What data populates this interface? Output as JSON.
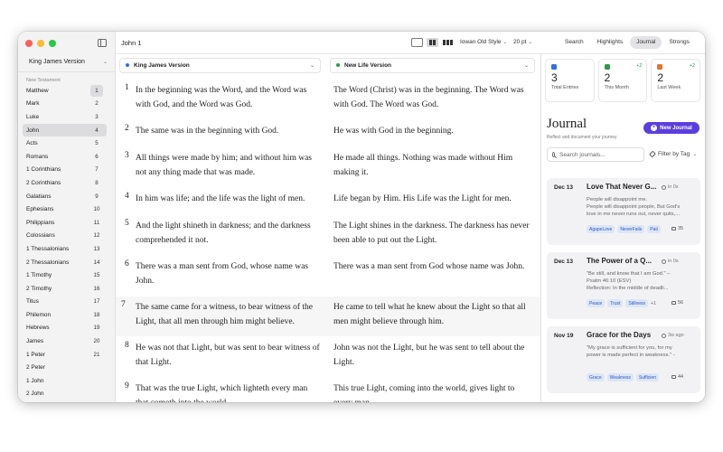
{
  "toolbar": {
    "chapter_title": "John 1",
    "font": "Iowan Old Style",
    "font_size": "20 pt",
    "segments": [
      "Search",
      "Highlights",
      "Journal",
      "Strongs"
    ],
    "active_segment": "Journal"
  },
  "sidebar": {
    "version": "King James Version",
    "section_label": "New Testament",
    "books": [
      "Matthew",
      "Mark",
      "Luke",
      "John",
      "Acts",
      "Romans",
      "1 Corinthians",
      "2 Corinthians",
      "Galatians",
      "Ephesians",
      "Philippians",
      "Colossians",
      "1 Thessalonians",
      "2 Thessalonians",
      "1 Timothy",
      "2 Timothy",
      "Titus",
      "Philemon",
      "Hebrews",
      "James",
      "1 Peter",
      "2 Peter",
      "1 John",
      "2 John"
    ],
    "active_book": "John",
    "chapters": [
      "1",
      "2",
      "3",
      "4",
      "5",
      "6",
      "7",
      "8",
      "9",
      "10",
      "11",
      "12",
      "13",
      "14",
      "15",
      "16",
      "17",
      "18",
      "19",
      "20",
      "21"
    ],
    "active_chapter": "1"
  },
  "bible": {
    "left_version": "King James Version",
    "right_version": "New Life Version",
    "left_dot_color": "#2f6fe0",
    "right_dot_color": "#2e9c4b",
    "highlighted_verse": "7",
    "verses": [
      {
        "num": "1",
        "kjv": "In the beginning was the Word, and the Word was with God, and the Word was God.",
        "nlv": "The Word (Christ) was in the beginning. The Word was with God. The Word was God."
      },
      {
        "num": "2",
        "kjv": "The same was in the beginning with God.",
        "nlv": "He was with God in the beginning."
      },
      {
        "num": "3",
        "kjv": "All things were made by him; and without him was not any thing made that was made.",
        "nlv": "He made all things. Nothing was made without Him making it."
      },
      {
        "num": "4",
        "kjv": "In him was life; and the life was the light of men.",
        "nlv": "Life began by Him. His Life was the Light for men."
      },
      {
        "num": "5",
        "kjv": "And the light shineth in darkness; and the darkness comprehended it not.",
        "nlv": "The Light shines in the darkness. The darkness has never been able to put out the Light."
      },
      {
        "num": "6",
        "kjv": "There was a man sent from God, whose name was John.",
        "nlv": "There was a man sent from God whose name was John."
      },
      {
        "num": "7",
        "kjv": "The same came for a witness, to bear witness of the Light, that all men through him might believe.",
        "nlv": "He came to tell what he knew about the Light so that all men might believe through him."
      },
      {
        "num": "8",
        "kjv": "He was not that Light, but was sent to bear witness of that Light.",
        "nlv": "John was not the Light, but he was sent to tell about the Light."
      },
      {
        "num": "9",
        "kjv": "That was the true Light, which lighteth every man that cometh into the world.",
        "nlv": "This true Light, coming into the world, gives light to every man."
      }
    ]
  },
  "journal": {
    "stats": [
      {
        "value": "3",
        "label": "Total Entries",
        "delta": "",
        "color": "#2f6fe0"
      },
      {
        "value": "2",
        "label": "This Month",
        "delta": "+2",
        "color": "#2e9c4b"
      },
      {
        "value": "2",
        "label": "Last Week",
        "delta": "+2",
        "color": "#e8722a"
      }
    ],
    "title": "Journal",
    "subtitle": "Reflect and document your journey",
    "new_button": "New Journal",
    "search_placeholder": "Search journals...",
    "filter_label": "Filter by Tag",
    "entries": [
      {
        "date": "Dec 13",
        "title": "Love That Never G...",
        "time": "in 0s",
        "preview": "People will disappoint me.\nPeople will disappoint people, But God's love in me never runs out, never quits,...",
        "tags": [
          "AgapeLove",
          "NeverFails",
          "Pati"
        ],
        "more": "",
        "comments": "35"
      },
      {
        "date": "Dec 13",
        "title": "The Power of a Q...",
        "time": "in 0s",
        "preview": "\"Be still, and know that I am God.\" – Psalm 46:10 (ESV)\nReflection: In the middle of deadli...",
        "tags": [
          "Peace",
          "Trust",
          "Stillness"
        ],
        "more": "+1",
        "comments": "56"
      },
      {
        "date": "Nov 19",
        "title": "Grace for the Days",
        "time": "3w ago",
        "preview": "\"My grace is sufficient for you, for my power is made perfect in weakness.\" -",
        "tags": [
          "Grace",
          "Weakness",
          "Sufficien"
        ],
        "more": "",
        "comments": "44"
      }
    ]
  }
}
